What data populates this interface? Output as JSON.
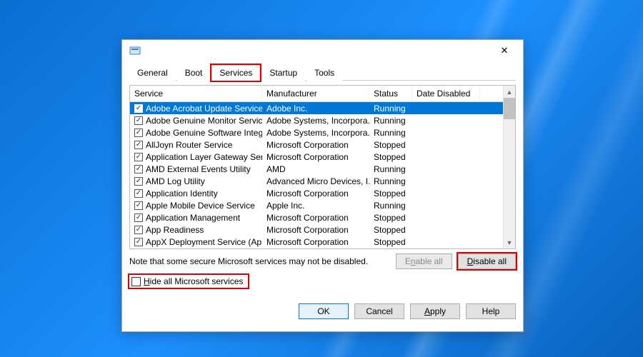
{
  "tabs": {
    "general": "General",
    "boot": "Boot",
    "services": "Services",
    "startup": "Startup",
    "tools": "Tools"
  },
  "columns": {
    "service": "Service",
    "manufacturer": "Manufacturer",
    "status": "Status",
    "date_disabled": "Date Disabled"
  },
  "rows": [
    {
      "service": "Adobe Acrobat Update Service",
      "mfr": "Adobe Inc.",
      "status": "Running",
      "selected": true
    },
    {
      "service": "Adobe Genuine Monitor Service",
      "mfr": "Adobe Systems, Incorpora...",
      "status": "Running"
    },
    {
      "service": "Adobe Genuine Software Integri...",
      "mfr": "Adobe Systems, Incorpora...",
      "status": "Running"
    },
    {
      "service": "AllJoyn Router Service",
      "mfr": "Microsoft Corporation",
      "status": "Stopped"
    },
    {
      "service": "Application Layer Gateway Service",
      "mfr": "Microsoft Corporation",
      "status": "Stopped"
    },
    {
      "service": "AMD External Events Utility",
      "mfr": "AMD",
      "status": "Running"
    },
    {
      "service": "AMD Log Utility",
      "mfr": "Advanced Micro Devices, I...",
      "status": "Running"
    },
    {
      "service": "Application Identity",
      "mfr": "Microsoft Corporation",
      "status": "Stopped"
    },
    {
      "service": "Apple Mobile Device Service",
      "mfr": "Apple Inc.",
      "status": "Running"
    },
    {
      "service": "Application Management",
      "mfr": "Microsoft Corporation",
      "status": "Stopped"
    },
    {
      "service": "App Readiness",
      "mfr": "Microsoft Corporation",
      "status": "Stopped"
    },
    {
      "service": "AppX Deployment Service (AppX...",
      "mfr": "Microsoft Corporation",
      "status": "Stopped"
    }
  ],
  "note": "Note that some secure Microsoft services may not be disabled.",
  "buttons": {
    "enable_all_pre": "E",
    "enable_all_u": "n",
    "enable_all_post": "able all",
    "disable_all_pre": "",
    "disable_all_u": "D",
    "disable_all_post": "isable all",
    "ok": "OK",
    "cancel": "Cancel",
    "apply_pre": "",
    "apply_u": "A",
    "apply_post": "pply",
    "help": "Help"
  },
  "hide_label_pre": "",
  "hide_label_u": "H",
  "hide_label_post": "ide all Microsoft services"
}
